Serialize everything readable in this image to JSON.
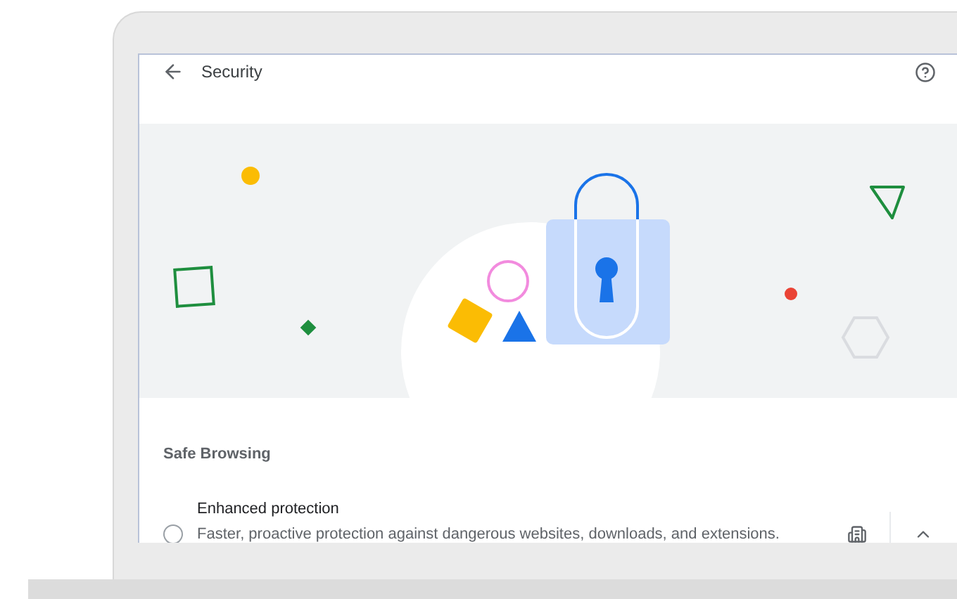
{
  "header": {
    "title": "Security"
  },
  "section": {
    "title": "Safe Browsing"
  },
  "options": [
    {
      "title": "Enhanced protection",
      "description": "Faster, proactive protection against dangerous websites, downloads, and extensions.",
      "selected": false,
      "expanded": true,
      "managed": true
    }
  ]
}
